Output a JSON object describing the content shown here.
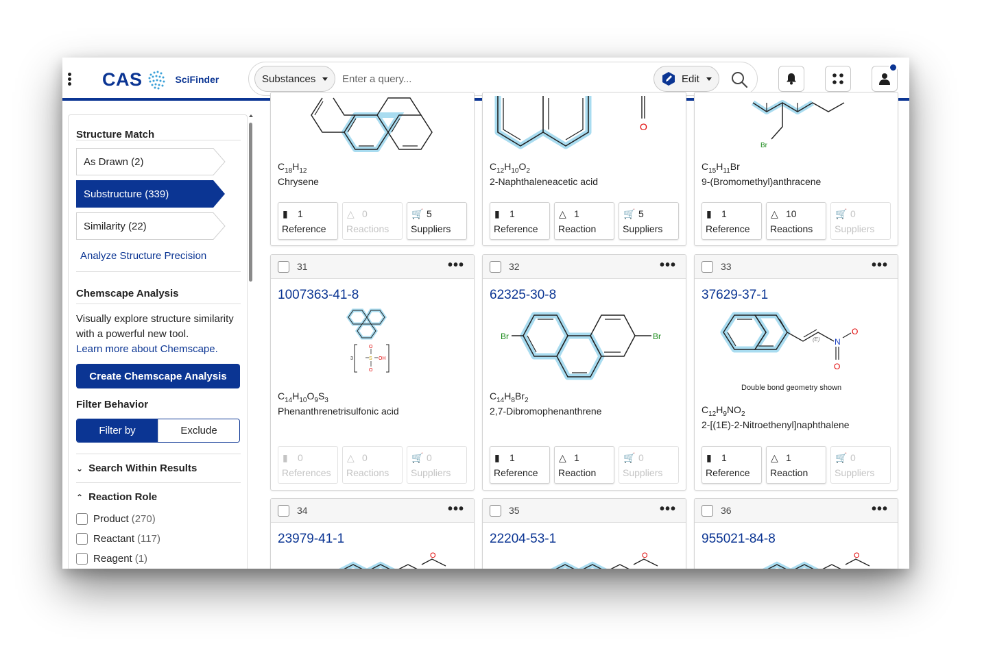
{
  "header": {
    "logo_text": "CAS",
    "product_name": "SciFinder",
    "search_type": "Substances",
    "query_placeholder": "Enter a query...",
    "edit_label": "Edit"
  },
  "sidebar": {
    "structure_match": {
      "title": "Structure Match",
      "options": [
        "As Drawn (2)",
        "Substructure (339)",
        "Similarity (22)"
      ],
      "selected": "Substructure (339)",
      "analyze_link": "Analyze Structure Precision"
    },
    "chemscape": {
      "title": "Chemscape Analysis",
      "description": "Visually explore structure similarity with a powerful new tool.",
      "learn_link": "Learn more about Chemscape.",
      "button": "Create Chemscape Analysis"
    },
    "filter_behavior": {
      "title": "Filter Behavior",
      "options": [
        "Filter by",
        "Exclude"
      ],
      "selected": "Filter by"
    },
    "search_within": {
      "label": "Search Within Results"
    },
    "reaction_role": {
      "label": "Reaction Role",
      "items": [
        {
          "label": "Product",
          "count": "(270)"
        },
        {
          "label": "Reactant",
          "count": "(117)"
        },
        {
          "label": "Reagent",
          "count": "(1)"
        }
      ]
    }
  },
  "results": {
    "top_row": [
      {
        "formula": [
          "C",
          "18",
          "H",
          "12"
        ],
        "name": "Chrysene",
        "stats": [
          {
            "value": "1",
            "label": "Reference",
            "enabled": true
          },
          {
            "value": "0",
            "label": "Reactions",
            "enabled": false
          },
          {
            "value": "5",
            "label": "Suppliers",
            "enabled": true
          }
        ]
      },
      {
        "formula": [
          "C",
          "12",
          "H",
          "10",
          "O",
          "2"
        ],
        "name": "2-Naphthaleneacetic acid",
        "stats": [
          {
            "value": "1",
            "label": "Reference",
            "enabled": true
          },
          {
            "value": "1",
            "label": "Reaction",
            "enabled": true
          },
          {
            "value": "5",
            "label": "Suppliers",
            "enabled": true
          }
        ]
      },
      {
        "formula": [
          "C",
          "15",
          "H",
          "11",
          "Br",
          ""
        ],
        "name": "9-(Bromomethyl)anthracene",
        "stats": [
          {
            "value": "1",
            "label": "Reference",
            "enabled": true
          },
          {
            "value": "10",
            "label": "Reactions",
            "enabled": true
          },
          {
            "value": "0",
            "label": "Suppliers",
            "enabled": false
          }
        ]
      }
    ],
    "middle_row": [
      {
        "number": "31",
        "cas_rn": "1007363-41-8",
        "formula": [
          "C",
          "14",
          "H",
          "10",
          "O",
          "9",
          "S",
          "3"
        ],
        "name": "Phenanthrenetrisulfonic acid",
        "stats": [
          {
            "value": "0",
            "label": "References",
            "enabled": false
          },
          {
            "value": "0",
            "label": "Reactions",
            "enabled": false
          },
          {
            "value": "0",
            "label": "Suppliers",
            "enabled": false
          }
        ]
      },
      {
        "number": "32",
        "cas_rn": "62325-30-8",
        "formula": [
          "C",
          "14",
          "H",
          "8",
          "Br",
          "2"
        ],
        "name": "2,7-Dibromophenanthrene",
        "stats": [
          {
            "value": "1",
            "label": "Reference",
            "enabled": true
          },
          {
            "value": "1",
            "label": "Reaction",
            "enabled": true
          },
          {
            "value": "0",
            "label": "Suppliers",
            "enabled": false
          }
        ]
      },
      {
        "number": "33",
        "cas_rn": "37629-37-1",
        "formula": [
          "C",
          "12",
          "H",
          "9",
          "NO",
          "2"
        ],
        "name": "2-[(1E)-2-Nitroethenyl]naphthalene",
        "note": "Double bond geometry shown",
        "stats": [
          {
            "value": "1",
            "label": "Reference",
            "enabled": true
          },
          {
            "value": "1",
            "label": "Reaction",
            "enabled": true
          },
          {
            "value": "0",
            "label": "Suppliers",
            "enabled": false
          }
        ]
      }
    ],
    "bottom_row": [
      {
        "number": "34",
        "cas_rn": "23979-41-1"
      },
      {
        "number": "35",
        "cas_rn": "22204-53-1"
      },
      {
        "number": "36",
        "cas_rn": "955021-84-8"
      }
    ],
    "atom_labels": {
      "oxygen": "O",
      "bromine": "Br",
      "nitrogen": "N",
      "sulfonic_s": "S",
      "sulfonic_oh": "OH",
      "sulfonic_o": "O",
      "sulfonic_mult": "3",
      "geometry_e": "(E)"
    }
  },
  "colors": {
    "brand": "#0b3593",
    "highlight": "#a9dcf0",
    "oxygen": "#e00000",
    "bromine": "#1a8a1a",
    "nitrogen": "#1a3fbf"
  }
}
